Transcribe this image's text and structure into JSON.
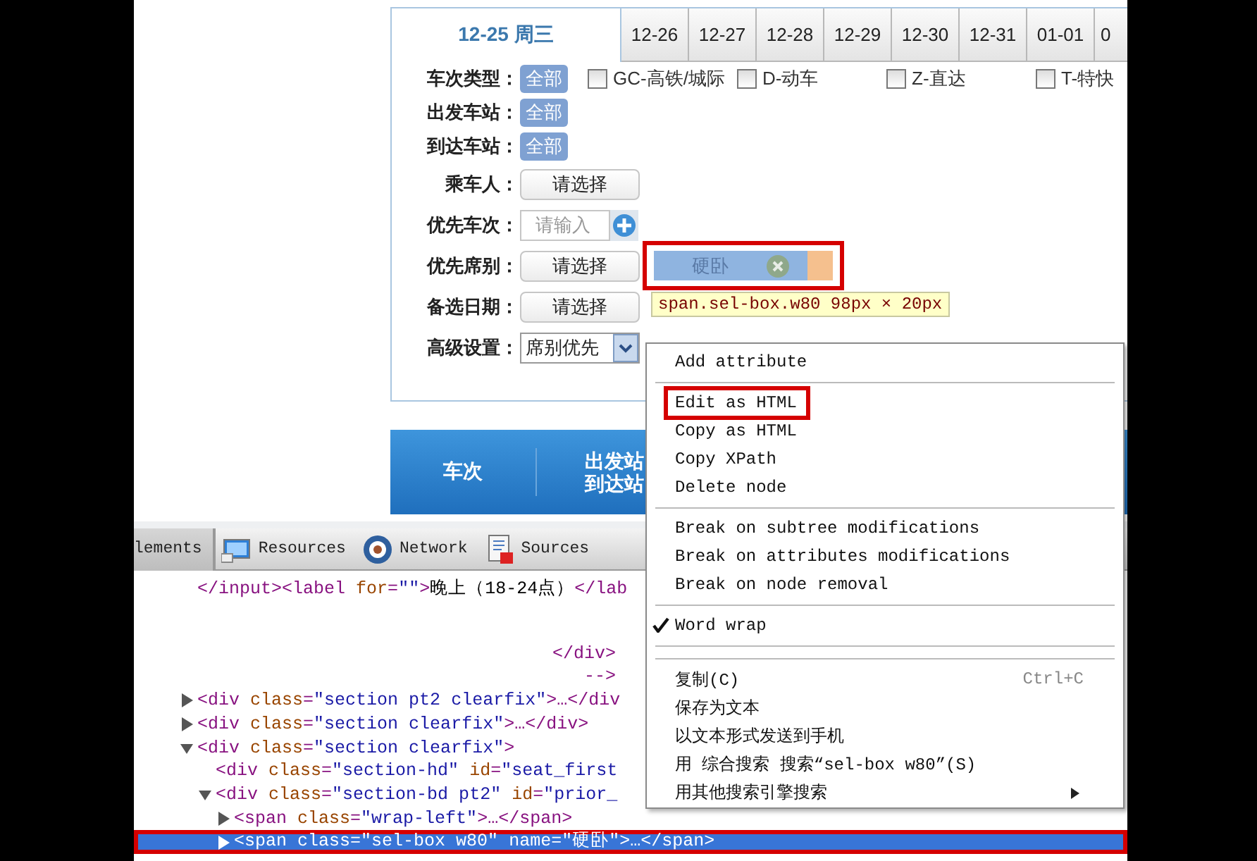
{
  "date_tabs": [
    {
      "label": "12-25 周三",
      "selected": true
    },
    {
      "label": "12-26",
      "selected": false
    },
    {
      "label": "12-27",
      "selected": false
    },
    {
      "label": "12-28",
      "selected": false
    },
    {
      "label": "12-29",
      "selected": false
    },
    {
      "label": "12-30",
      "selected": false
    },
    {
      "label": "12-31",
      "selected": false
    },
    {
      "label": "01-01",
      "selected": false
    },
    {
      "label": "0",
      "selected": false
    }
  ],
  "filter_rows": [
    {
      "kind": "tags",
      "label": "车次类型：",
      "all_button": "全部",
      "options": [
        {
          "label": "GC-高铁/城际",
          "checked": false
        },
        {
          "label": "D-动车",
          "checked": false
        },
        {
          "label": "Z-直达",
          "checked": false
        },
        {
          "label": "T-特快",
          "checked": false
        }
      ]
    },
    {
      "kind": "tags",
      "label": "出发车站：",
      "all_button": "全部"
    },
    {
      "kind": "tags",
      "label": "到达车站：",
      "all_button": "全部"
    },
    {
      "kind": "button",
      "label": "乘车人：",
      "button": "请选择"
    },
    {
      "kind": "input",
      "label": "优先车次：",
      "placeholder": "请输入"
    },
    {
      "kind": "button",
      "label": "优先席别：",
      "button": "请选择",
      "chip": {
        "text": "硬卧",
        "annotated": true
      },
      "tooltip": "span.sel-box.w80 98px × 20px"
    },
    {
      "kind": "button",
      "label": "备选日期：",
      "button": "请选择"
    },
    {
      "kind": "select",
      "label": "高级设置：",
      "value": "席别优先"
    }
  ],
  "results_header": {
    "columns": [
      {
        "lines": [
          "车次"
        ]
      },
      {
        "lines": [
          "出发站",
          "到达站"
        ]
      }
    ]
  },
  "devtools": {
    "tabs": [
      {
        "label": "lements",
        "selected": true
      },
      {
        "label": "Resources",
        "selected": false
      },
      {
        "label": "Network",
        "selected": false
      },
      {
        "label": "Sources",
        "selected": false
      }
    ],
    "lines": [
      {
        "kind": "text",
        "tokens": [
          {
            "kind": "tag",
            "text": "</input><label "
          },
          {
            "kind": "attr",
            "text": "for"
          },
          {
            "kind": "tag",
            "text": "="
          },
          {
            "kind": "value",
            "text": "\"\""
          },
          {
            "kind": "tag",
            "text": ">"
          },
          {
            "kind": "text",
            "text": "晚上（18-24点）"
          },
          {
            "kind": "tag",
            "text": "</lab"
          }
        ]
      },
      {
        "kind": "continuation",
        "tokens": [
          {
            "kind": "tag",
            "text": "</div>"
          }
        ]
      },
      {
        "kind": "continuation",
        "tokens": [
          {
            "kind": "tag",
            "text": "-->"
          }
        ]
      },
      {
        "kind": "node",
        "expanded": false,
        "selected": false,
        "tokens": [
          {
            "kind": "tag",
            "text": "<div "
          },
          {
            "kind": "attr",
            "text": "class"
          },
          {
            "kind": "tag",
            "text": "="
          },
          {
            "kind": "value",
            "text": "\"section pt2 clearfix\""
          },
          {
            "kind": "tag",
            "text": ">…</div"
          }
        ]
      },
      {
        "kind": "node",
        "expanded": false,
        "selected": false,
        "tokens": [
          {
            "kind": "tag",
            "text": "<div "
          },
          {
            "kind": "attr",
            "text": "class"
          },
          {
            "kind": "tag",
            "text": "="
          },
          {
            "kind": "value",
            "text": "\"section clearfix\""
          },
          {
            "kind": "tag",
            "text": ">…</div>"
          }
        ]
      },
      {
        "kind": "node",
        "expanded": true,
        "selected": false,
        "tokens": [
          {
            "kind": "tag",
            "text": "<div "
          },
          {
            "kind": "attr",
            "text": "class"
          },
          {
            "kind": "tag",
            "text": "="
          },
          {
            "kind": "value",
            "text": "\"section clearfix\""
          },
          {
            "kind": "tag",
            "text": ">"
          }
        ],
        "children": [
          {
            "selected": false,
            "tokens": [
              {
                "kind": "tag",
                "text": "<div "
              },
              {
                "kind": "attr",
                "text": "class"
              },
              {
                "kind": "tag",
                "text": "="
              },
              {
                "kind": "value",
                "text": "\"section-hd\" "
              },
              {
                "kind": "attr",
                "text": "id"
              },
              {
                "kind": "tag",
                "text": "="
              },
              {
                "kind": "value",
                "text": "\"seat_first"
              }
            ]
          },
          {
            "expanded": true,
            "selected": false,
            "tokens": [
              {
                "kind": "tag",
                "text": "<div "
              },
              {
                "kind": "attr",
                "text": "class"
              },
              {
                "kind": "tag",
                "text": "="
              },
              {
                "kind": "value",
                "text": "\"section-bd pt2\" "
              },
              {
                "kind": "attr",
                "text": "id"
              },
              {
                "kind": "tag",
                "text": "="
              },
              {
                "kind": "value",
                "text": "\"prior_"
              }
            ],
            "children": [
              {
                "expanded": false,
                "selected": false,
                "tokens": [
                  {
                    "kind": "tag",
                    "text": "<span "
                  },
                  {
                    "kind": "attr",
                    "text": "class"
                  },
                  {
                    "kind": "tag",
                    "text": "="
                  },
                  {
                    "kind": "value",
                    "text": "\"wrap-left\""
                  },
                  {
                    "kind": "tag",
                    "text": ">…</span>"
                  }
                ]
              },
              {
                "expanded": false,
                "selected": true,
                "annotated": true,
                "tokens": [
                  {
                    "kind": "tag",
                    "text": "<span "
                  },
                  {
                    "kind": "attr",
                    "text": "class"
                  },
                  {
                    "kind": "tag",
                    "text": "="
                  },
                  {
                    "kind": "value",
                    "text": "\"sel-box w80\" "
                  },
                  {
                    "kind": "attr",
                    "text": "name"
                  },
                  {
                    "kind": "tag",
                    "text": "="
                  },
                  {
                    "kind": "value",
                    "text": "\"硬卧\""
                  },
                  {
                    "kind": "tag",
                    "text": ">…</span>"
                  }
                ]
              }
            ]
          }
        ]
      }
    ]
  },
  "context_menu": [
    {
      "kind": "item",
      "label": "Add attribute"
    },
    {
      "kind": "separator"
    },
    {
      "kind": "item",
      "label": "Edit as HTML",
      "annotated": true
    },
    {
      "kind": "item",
      "label": "Copy as HTML"
    },
    {
      "kind": "item",
      "label": "Copy XPath"
    },
    {
      "kind": "item",
      "label": "Delete node"
    },
    {
      "kind": "separator"
    },
    {
      "kind": "item",
      "label": "Break on subtree modifications"
    },
    {
      "kind": "item",
      "label": "Break on attributes modifications"
    },
    {
      "kind": "item",
      "label": "Break on node removal"
    },
    {
      "kind": "separator"
    },
    {
      "kind": "check",
      "label": "Word wrap",
      "checked": true
    },
    {
      "kind": "separator"
    },
    {
      "kind": "separator"
    },
    {
      "kind": "item",
      "label": "复制(C)",
      "shortcut": "Ctrl+C"
    },
    {
      "kind": "item",
      "label": "保存为文本"
    },
    {
      "kind": "item",
      "label": "以文本形式发送到手机"
    },
    {
      "kind": "item",
      "label": "用 综合搜索 搜索“sel-box w80”(S)"
    },
    {
      "kind": "submenu",
      "label": "用其他搜索引擎搜索"
    }
  ]
}
